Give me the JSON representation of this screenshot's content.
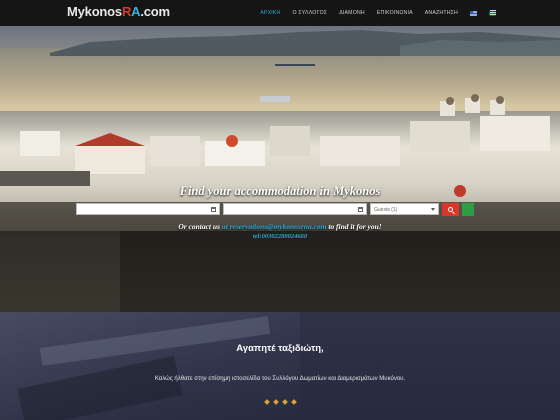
{
  "brand": {
    "logo_part1": "Mykonos",
    "logo_part2": "R",
    "logo_part3": "A",
    "logo_part4": ".com"
  },
  "nav": {
    "items": [
      {
        "label": "ΑΡΧΙΚΗ",
        "active": true
      },
      {
        "label": "Ο ΣΥΛΛΟΓΟΣ",
        "active": false
      },
      {
        "label": "ΔΙΑΜΟΝΗ",
        "active": false
      },
      {
        "label": "ΕΠΙΚΟΙΝΩΝΙΑ",
        "active": false
      },
      {
        "label": "ΑΝΑΖΗΤΗΣΗ",
        "active": false
      }
    ],
    "languages": [
      "greek-flag-icon",
      "uk-flag-icon"
    ]
  },
  "hero": {
    "title": "Find your accommodation in Mykonos",
    "checkin_value": "",
    "checkout_value": "",
    "guests_value": "Guests (1)",
    "contact_prefix": "Or contact us",
    "contact_at": "at",
    "contact_email": "reservations@mykonosrna.com",
    "contact_suffix": "to find it for you!",
    "contact_phone": "tel:00302289024660"
  },
  "welcome": {
    "title": "Αγαπητέ ταξιδιώτη,",
    "text": "Καλώς ήλθατε στην επίσημη ιστοσελίδα του Συλλόγου Δωματίων και Διαμερισμάτων Μυκόνου."
  },
  "colors": {
    "accent_blue": "#2ba8d8",
    "brand_red": "#d9372b",
    "search_green": "#2e9e44",
    "gold": "#d9a23a"
  }
}
